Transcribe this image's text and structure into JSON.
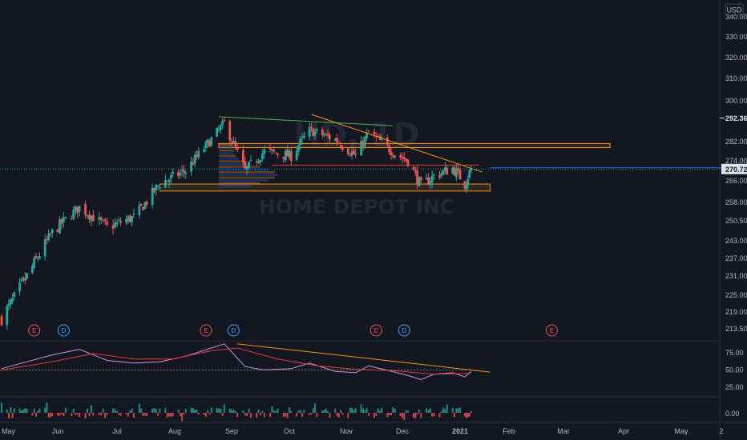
{
  "header": {
    "currency": "USD"
  },
  "watermark": {
    "symbol": "HD, 1D",
    "name": "HOME DEPOT INC"
  },
  "colors": {
    "background": "#131722",
    "up": "#26a69a",
    "down": "#ef5350",
    "grid": "#1e222d",
    "axis_text": "#b2b5be",
    "orange": "#f7931a",
    "red_line": "#e53935",
    "green_line": "#4caf50",
    "ema": "#e53935",
    "oscillator": "#ce93d8",
    "blue_line": "#2962ff"
  },
  "chart_data": [
    {
      "type": "candlestick",
      "x_axis": {
        "labels": [
          "May",
          "Jun",
          "Jul",
          "Aug",
          "Sep",
          "Oct",
          "Nov",
          "Dec",
          "2021",
          "Feb",
          "Mar",
          "Apr",
          "May",
          "2"
        ]
      },
      "y_axis": {
        "ticks": [
          "340.00",
          "330.00",
          "320.00",
          "310.00",
          "300.00",
          "282.00",
          "274.00",
          "266.00",
          "258.00",
          "250.50",
          "243.00",
          "237.00",
          "231.00",
          "225.00",
          "219.00",
          "213.50"
        ]
      },
      "close_points": [
        {
          "date": "2020-05-01",
          "close": 217
        },
        {
          "date": "2020-05-15",
          "close": 231
        },
        {
          "date": "2020-05-29",
          "close": 246
        },
        {
          "date": "2020-06-12",
          "close": 256
        },
        {
          "date": "2020-06-26",
          "close": 248
        },
        {
          "date": "2020-07-10",
          "close": 252
        },
        {
          "date": "2020-07-24",
          "close": 265
        },
        {
          "date": "2020-08-07",
          "close": 270
        },
        {
          "date": "2020-08-21",
          "close": 283
        },
        {
          "date": "2020-08-28",
          "close": 290
        },
        {
          "date": "2020-09-08",
          "close": 270
        },
        {
          "date": "2020-09-18",
          "close": 278
        },
        {
          "date": "2020-10-02",
          "close": 276
        },
        {
          "date": "2020-10-12",
          "close": 287
        },
        {
          "date": "2020-10-26",
          "close": 283
        },
        {
          "date": "2020-11-06",
          "close": 276
        },
        {
          "date": "2020-11-13",
          "close": 286
        },
        {
          "date": "2020-11-27",
          "close": 277
        },
        {
          "date": "2020-12-04",
          "close": 274
        },
        {
          "date": "2020-12-11",
          "close": 264
        },
        {
          "date": "2020-12-18",
          "close": 268
        },
        {
          "date": "2020-12-28",
          "close": 271
        },
        {
          "date": "2021-01-04",
          "close": 265
        },
        {
          "date": "2021-01-08",
          "close": 270.72
        }
      ],
      "price_markers": [
        {
          "label": "292.36",
          "value": 292.36,
          "kind": "high"
        },
        {
          "label": "270.72",
          "value": 270.72,
          "kind": "last"
        }
      ],
      "zones": [
        {
          "name": "resistance-zone",
          "from": "2020-08-25",
          "to": "2021-03-25",
          "low": 279.5,
          "high": 281.2,
          "color": "#f7931a"
        },
        {
          "name": "support-zone",
          "from": "2020-07-24",
          "to": "2021-01-20",
          "low": 262.2,
          "high": 264.8,
          "color": "#f7931a"
        }
      ],
      "lines": [
        {
          "name": "descending-trendline",
          "from": [
            "2020-10-13",
            294
          ],
          "to": [
            "2021-01-15",
            269.5
          ],
          "color": "#f7931a"
        },
        {
          "name": "top-green-line",
          "from": [
            "2020-08-25",
            293
          ],
          "to": [
            "2020-11-26",
            289
          ],
          "color": "#4caf50"
        },
        {
          "name": "red-horizontal",
          "from": [
            "2020-09-22",
            272.3
          ],
          "to": [
            "2021-01-13",
            272.3
          ],
          "color": "#e53935"
        },
        {
          "name": "blue-horizontal",
          "from": [
            "2021-01-20",
            271.2
          ],
          "to": [
            "2021-05-26",
            271.2
          ],
          "color": "#2962ff"
        }
      ],
      "event_badges": [
        {
          "label": "E",
          "date": "2020-05-19",
          "kind": "earnings"
        },
        {
          "label": "D",
          "date": "2020-06-04",
          "kind": "dividend"
        },
        {
          "label": "E",
          "date": "2020-08-18",
          "kind": "earnings"
        },
        {
          "label": "D",
          "date": "2020-09-02",
          "kind": "dividend"
        },
        {
          "label": "E",
          "date": "2020-11-17",
          "kind": "earnings"
        },
        {
          "label": "D",
          "date": "2020-12-02",
          "kind": "dividend"
        },
        {
          "label": "E",
          "date": "2021-02-23",
          "kind": "earnings"
        }
      ]
    },
    {
      "type": "line",
      "y_axis": {
        "ticks": [
          "75.00",
          "50.00",
          "25.00"
        ]
      },
      "reference_level": 50,
      "series": [
        {
          "values_by_date": [
            [
              "2020-05-01",
              52
            ],
            [
              "2020-05-15",
              62
            ],
            [
              "2020-05-29",
              72
            ],
            [
              "2020-06-12",
              80
            ],
            [
              "2020-06-26",
              64
            ],
            [
              "2020-07-10",
              60
            ],
            [
              "2020-07-24",
              62
            ],
            [
              "2020-08-07",
              70
            ],
            [
              "2020-08-21",
              82
            ],
            [
              "2020-08-28",
              88
            ],
            [
              "2020-09-08",
              55
            ],
            [
              "2020-09-18",
              50
            ],
            [
              "2020-10-02",
              52
            ],
            [
              "2020-10-12",
              60
            ],
            [
              "2020-10-26",
              48
            ],
            [
              "2020-11-06",
              46
            ],
            [
              "2020-11-13",
              56
            ],
            [
              "2020-11-27",
              47
            ],
            [
              "2020-12-04",
              42
            ],
            [
              "2020-12-11",
              36
            ],
            [
              "2020-12-18",
              44
            ],
            [
              "2020-12-28",
              46
            ],
            [
              "2021-01-04",
              40
            ],
            [
              "2021-01-08",
              48
            ]
          ]
        },
        {
          "values_by_date": [
            [
              "2020-05-01",
              50
            ],
            [
              "2020-05-29",
              62
            ],
            [
              "2020-06-19",
              74
            ],
            [
              "2020-07-10",
              66
            ],
            [
              "2020-07-31",
              66
            ],
            [
              "2020-08-21",
              78
            ],
            [
              "2020-09-04",
              82
            ],
            [
              "2020-09-25",
              66
            ],
            [
              "2020-10-16",
              56
            ],
            [
              "2020-11-06",
              51
            ],
            [
              "2020-11-27",
              49
            ],
            [
              "2020-12-18",
              44
            ],
            [
              "2021-01-08",
              45
            ]
          ]
        }
      ],
      "trendline": {
        "from": [
          "2020-09-04",
          88
        ],
        "to": [
          "2021-01-20",
          47
        ]
      }
    },
    {
      "type": "bar",
      "y_axis": {
        "ticks": [
          "0.00"
        ]
      }
    }
  ]
}
